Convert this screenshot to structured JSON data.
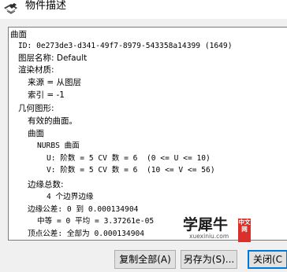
{
  "window": {
    "title": "物件描述",
    "icon": "app-icon"
  },
  "content": {
    "lines": [
      "曲面",
      "ID: 0e273de3-d341-49f7-8979-543358a14399 (1649)",
      "图层名称: Default",
      "渲染材质:",
      "来源 = 从图层",
      "索引 = -1",
      "几何图形:",
      "有效的曲面。",
      "曲面",
      "NURBS 曲面",
      "U: 阶数 = 5 CV 数 = 6  (0 <= U <= 10)",
      "V: 阶数 = 5 CV 数 = 6  (10 <= V <= 56)",
      "边缘总数:",
      "4 个边界边缘",
      "边缘公差: 0 到 0.000134904",
      "中等 = 0 平均 = 3.37261e-05",
      "顶点公差: 全部为 0.000134904"
    ]
  },
  "watermark": {
    "text": "学犀牛",
    "url": "xuexiniu.com",
    "badge": "中文网"
  },
  "buttons": {
    "copy_all": "复制全部(A)",
    "save_as": "另存为(S)...",
    "close": "关闭(C"
  }
}
